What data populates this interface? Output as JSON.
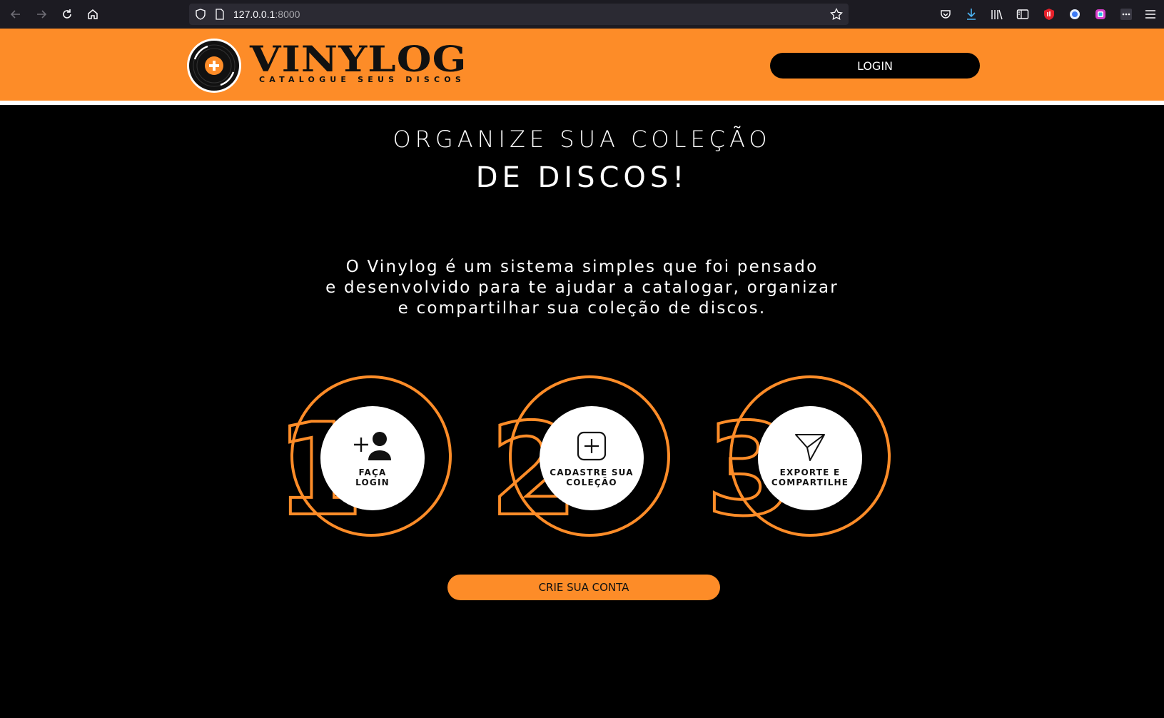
{
  "browser": {
    "url_host": "127.0.0.1",
    "url_port": ":8000",
    "icons": [
      "back-icon",
      "forward-icon",
      "reload-icon",
      "home-icon",
      "shield-icon",
      "page-icon",
      "bookmark-star-icon",
      "pocket-icon",
      "download-icon",
      "library-icon",
      "sidebar-icon",
      "extension-red-icon",
      "extension-blue-icon",
      "extension-color-icon",
      "extensions-overflow-icon",
      "menu-icon"
    ]
  },
  "header": {
    "logo_word": "VINYLOG",
    "logo_tagline": "CATALOGUE SEUS DISCOS",
    "login_label": "LOGIN"
  },
  "hero": {
    "line1": "ORGANIZE SUA COLEÇÃO",
    "line2": "DE DISCOS!"
  },
  "description": {
    "line1": "O Vinylog é um sistema simples que foi pensado",
    "line2": "e desenvolvido para te ajudar a catalogar, organizar",
    "line3": "e compartilhar sua coleção de discos."
  },
  "steps": [
    {
      "number": "1",
      "label_line1": "FAÇA",
      "label_line2": "LOGIN",
      "icon": "add-user-icon"
    },
    {
      "number": "2",
      "label_line1": "CADASTRE SUA",
      "label_line2": "COLEÇÃO",
      "icon": "add-square-icon"
    },
    {
      "number": "3",
      "label_line1": "EXPORTE E",
      "label_line2": "COMPARTILHE",
      "icon": "send-icon"
    }
  ],
  "cta": {
    "label": "CRIE SUA CONTA"
  },
  "colors": {
    "accent": "#fd8c28",
    "background": "#000000",
    "chrome": "#1c1b22"
  }
}
